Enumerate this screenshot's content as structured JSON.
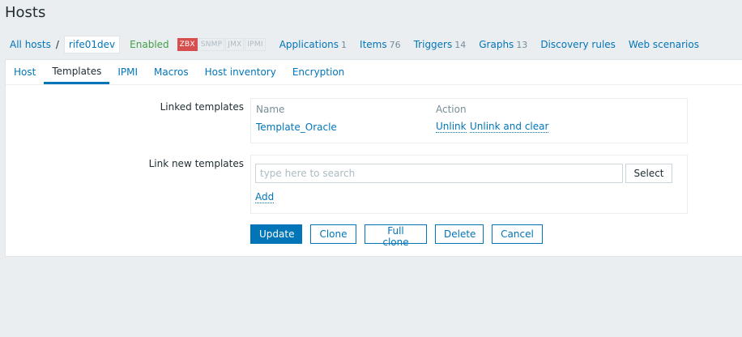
{
  "page": {
    "title": "Hosts"
  },
  "host_nav": {
    "all_hosts": "All hosts",
    "separator": "/",
    "current_host": "rife01dev",
    "status": "Enabled",
    "availability": [
      "ZBX",
      "SNMP",
      "JMX",
      "IPMI"
    ],
    "links": [
      {
        "label": "Applications",
        "count": "1"
      },
      {
        "label": "Items",
        "count": "76"
      },
      {
        "label": "Triggers",
        "count": "14"
      },
      {
        "label": "Graphs",
        "count": "13"
      },
      {
        "label": "Discovery rules",
        "count": ""
      },
      {
        "label": "Web scenarios",
        "count": ""
      }
    ]
  },
  "tabs": [
    "Host",
    "Templates",
    "IPMI",
    "Macros",
    "Host inventory",
    "Encryption"
  ],
  "active_tab": "Templates",
  "linked_templates": {
    "label": "Linked templates",
    "col_name": "Name",
    "col_action": "Action",
    "items": [
      {
        "name": "Template_Oracle",
        "unlink": "Unlink",
        "unlink_clear": "Unlink and clear"
      }
    ]
  },
  "link_new": {
    "label": "Link new templates",
    "placeholder": "type here to search",
    "value": "",
    "select_label": "Select",
    "add_label": "Add"
  },
  "buttons": {
    "update": "Update",
    "clone": "Clone",
    "full_clone": "Full clone",
    "delete": "Delete",
    "cancel": "Cancel"
  },
  "colors": {
    "accent": "#0275b8",
    "enabled": "#429e47",
    "zbx_error": "#d64e4e",
    "background": "#ebeef0"
  }
}
